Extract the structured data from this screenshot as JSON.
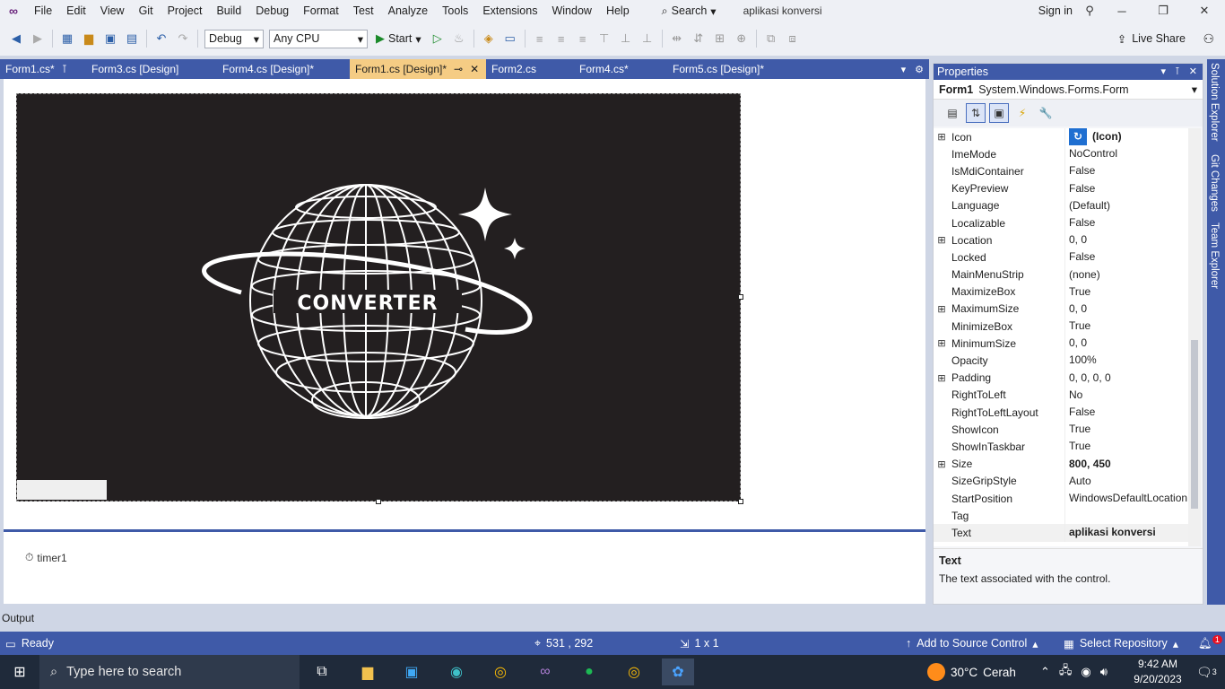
{
  "colors": {
    "accent": "#3f5aa8",
    "active_tab": "#f5cc84",
    "canvas": "#231f20",
    "taskbar": "#1f2a3a"
  },
  "menubar": {
    "items": [
      "File",
      "Edit",
      "View",
      "Git",
      "Project",
      "Build",
      "Debug",
      "Format",
      "Test",
      "Analyze",
      "Tools",
      "Extensions",
      "Window",
      "Help"
    ],
    "search_label": "Search",
    "window_title": "aplikasi konversi",
    "sign_in": "Sign in"
  },
  "toolbar": {
    "config": "Debug",
    "platform": "Any CPU",
    "start_label": "Start",
    "live_share": "Live Share"
  },
  "doc_tabs": [
    {
      "label": "Form1.cs*",
      "active": false
    },
    {
      "label": "Form3.cs [Design]",
      "active": false
    },
    {
      "label": "Form4.cs [Design]*",
      "active": false
    },
    {
      "label": "Form1.cs [Design]*",
      "active": true
    },
    {
      "label": "Form2.cs",
      "active": false
    },
    {
      "label": "Form4.cs*",
      "active": false
    },
    {
      "label": "Form5.cs [Design]*",
      "active": false
    }
  ],
  "designer": {
    "logo_text": "CONVERTER",
    "component": "timer1"
  },
  "output_label": "Output",
  "properties": {
    "title": "Properties",
    "object_name": "Form1",
    "object_type": "System.Windows.Forms.Form",
    "rows": [
      {
        "name": "Icon",
        "value": "(Icon)",
        "expandable": true,
        "bold": true
      },
      {
        "name": "ImeMode",
        "value": "NoControl",
        "expandable": false,
        "bold": false
      },
      {
        "name": "IsMdiContainer",
        "value": "False",
        "expandable": false,
        "bold": false
      },
      {
        "name": "KeyPreview",
        "value": "False",
        "expandable": false,
        "bold": false
      },
      {
        "name": "Language",
        "value": "(Default)",
        "expandable": false,
        "bold": false
      },
      {
        "name": "Localizable",
        "value": "False",
        "expandable": false,
        "bold": false
      },
      {
        "name": "Location",
        "value": "0, 0",
        "expandable": true,
        "bold": false
      },
      {
        "name": "Locked",
        "value": "False",
        "expandable": false,
        "bold": false
      },
      {
        "name": "MainMenuStrip",
        "value": "(none)",
        "expandable": false,
        "bold": false
      },
      {
        "name": "MaximizeBox",
        "value": "True",
        "expandable": false,
        "bold": false
      },
      {
        "name": "MaximumSize",
        "value": "0, 0",
        "expandable": true,
        "bold": false
      },
      {
        "name": "MinimizeBox",
        "value": "True",
        "expandable": false,
        "bold": false
      },
      {
        "name": "MinimumSize",
        "value": "0, 0",
        "expandable": true,
        "bold": false
      },
      {
        "name": "Opacity",
        "value": "100%",
        "expandable": false,
        "bold": false
      },
      {
        "name": "Padding",
        "value": "0, 0, 0, 0",
        "expandable": true,
        "bold": false
      },
      {
        "name": "RightToLeft",
        "value": "No",
        "expandable": false,
        "bold": false
      },
      {
        "name": "RightToLeftLayout",
        "value": "False",
        "expandable": false,
        "bold": false
      },
      {
        "name": "ShowIcon",
        "value": "True",
        "expandable": false,
        "bold": false
      },
      {
        "name": "ShowInTaskbar",
        "value": "True",
        "expandable": false,
        "bold": false
      },
      {
        "name": "Size",
        "value": "800, 450",
        "expandable": true,
        "bold": true
      },
      {
        "name": "SizeGripStyle",
        "value": "Auto",
        "expandable": false,
        "bold": false
      },
      {
        "name": "StartPosition",
        "value": "WindowsDefaultLocation",
        "expandable": false,
        "bold": false
      },
      {
        "name": "Tag",
        "value": "",
        "expandable": false,
        "bold": false
      },
      {
        "name": "Text",
        "value": "aplikasi konversi",
        "expandable": false,
        "bold": true,
        "selected": true
      }
    ],
    "desc_title": "Text",
    "desc_text": "The text associated with the control."
  },
  "right_strip": [
    "Solution Explorer",
    "Git Changes",
    "Team Explorer"
  ],
  "statusbar": {
    "ready": "Ready",
    "position": "531 , 292",
    "size": "1 x 1",
    "source_control": "Add to Source Control",
    "repository": "Select Repository",
    "notification_count": "1"
  },
  "taskbar": {
    "search_placeholder": "Type here to search",
    "weather_temp": "30°C",
    "weather_text": "Cerah",
    "time": "9:42 AM",
    "date": "9/20/2023",
    "notifications": "3"
  }
}
